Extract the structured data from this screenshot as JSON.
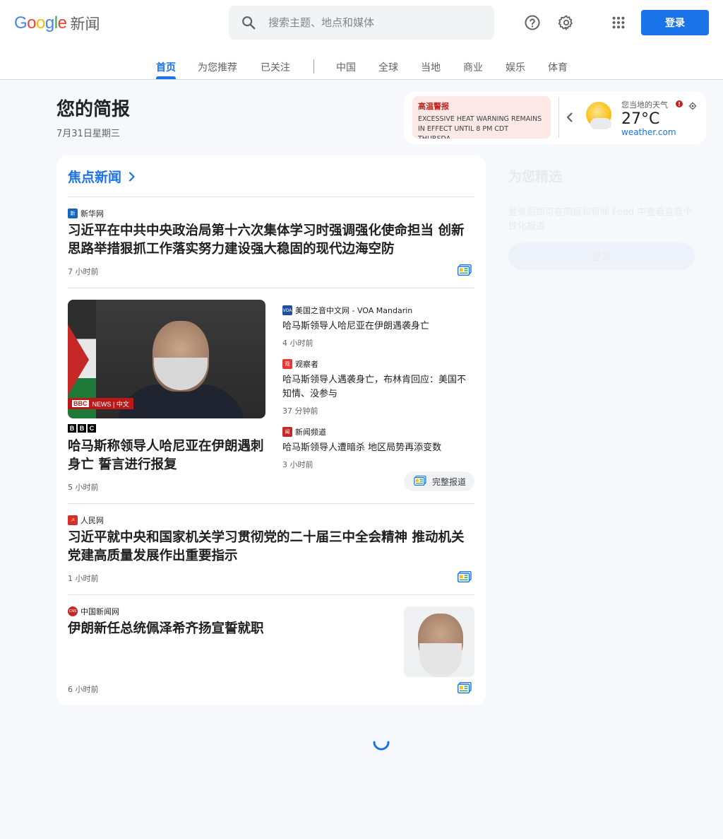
{
  "header": {
    "logo_google": "Google",
    "logo_news": "新闻",
    "search_placeholder": "搜索主题、地点和媒体",
    "login_label": "登录"
  },
  "nav": {
    "tabs": [
      "首页",
      "为您推荐",
      "已关注",
      "中国",
      "全球",
      "当地",
      "商业",
      "娱乐",
      "体育"
    ],
    "active_index": 0
  },
  "briefing": {
    "title": "您的简报",
    "date": "7月31日星期三"
  },
  "weather": {
    "alert_title": "高温警报",
    "alert_text": "EXCESSIVE HEAT WARNING REMAINS IN EFFECT UNTIL 8 PM CDT THURSDA...",
    "label": "您当地的天气",
    "temperature": "27°C",
    "source": "weather.com"
  },
  "top_stories": {
    "title": "焦点新闻",
    "story1": {
      "source": "新华网",
      "headline": "习近平在中共中央政治局第十六次集体学习时强调强化使命担当 创新思路举措狠抓工作落实努力建设强大稳固的现代边海空防",
      "time": "7 小时前"
    },
    "story2": {
      "image_badge": "NEWS | 中文",
      "source_logo": [
        "B",
        "B",
        "C"
      ],
      "headline": "哈马斯称领导人哈尼亚在伊朗遇刺身亡 誓言进行报复",
      "time": "5 小时前",
      "related": [
        {
          "source": "美国之音中文网 - VOA Mandarin",
          "headline": "哈马斯领导人哈尼亚在伊朗遇袭身亡",
          "time": "4 小时前"
        },
        {
          "source": "观察者",
          "headline": "哈马斯领导人遇袭身亡，布林肯回应：美国不知情、没参与",
          "time": "37 分钟前"
        },
        {
          "source": "新闻频道",
          "headline": "哈马斯领导人遭暗杀 地区局势再添变数",
          "time": "3 小时前"
        }
      ],
      "full_coverage": "完整报道"
    },
    "story3": {
      "source": "人民网",
      "headline": "习近平就中央和国家机关学习贯彻党的二十届三中全会精神 推动机关党建高质量发展作出重要指示",
      "time": "1 小时前"
    },
    "story4": {
      "source": "中国新闻网",
      "headline": "伊朗新任总统佩泽希齐扬宣誓就职",
      "time": "6 小时前"
    }
  },
  "picks": {
    "title": "为您精选",
    "description": "登录后即可在简报和新闻 Feed 中查看查看个性化报道",
    "button": "登录"
  },
  "colors": {
    "accent": "#1a73e8",
    "alert": "#c5221f"
  }
}
